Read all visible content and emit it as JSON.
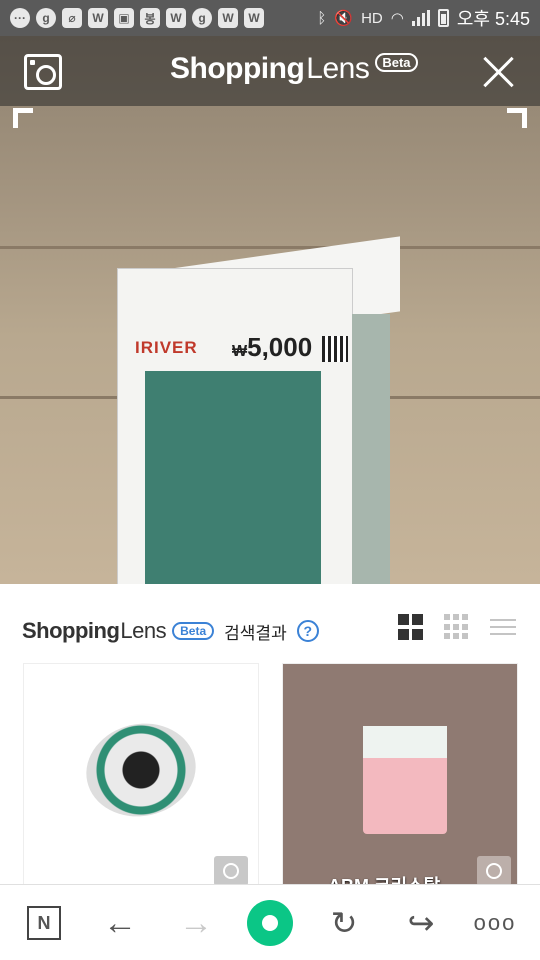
{
  "status_bar": {
    "icons": [
      "chat-icon",
      "g-icon",
      "pill-icon",
      "w-icon",
      "image-icon",
      "bong-icon",
      "w-icon",
      "g-icon",
      "w-icon",
      "w-icon",
      "bluetooth-icon",
      "mute-icon",
      "hd-icon",
      "wifi-icon",
      "signal-icon",
      "battery-icon"
    ],
    "left_icon_text": [
      "···",
      "g",
      "⌀",
      "W",
      "▣",
      "봉",
      "W",
      "g",
      "W",
      "W"
    ],
    "hd": "HD",
    "time": "오후 5:45"
  },
  "camera": {
    "title_bold": "Shopping",
    "title_light": "Lens",
    "beta": "Beta",
    "product_brand": "IRIVER",
    "product_price_symbol": "₩",
    "product_price": "5,000"
  },
  "results": {
    "title_bold": "Shopping",
    "title_light": "Lens",
    "beta": "Beta",
    "label": "검색결과",
    "help": "?",
    "view_modes": [
      "grid-2-icon",
      "grid-3-icon",
      "list-icon"
    ],
    "items": [
      {
        "name": "solder-reel",
        "caption": ""
      },
      {
        "name": "crystal-scrubber",
        "caption": "ABM 크리스탈"
      }
    ]
  },
  "nav": {
    "n_label": "N",
    "back": "←",
    "forward": "→",
    "refresh": "↻",
    "share": "↪",
    "more": "ooo"
  },
  "colors": {
    "status_bar": "#5a5a5a",
    "accent_blue": "#3b82d6",
    "home_green": "#0bc686"
  }
}
